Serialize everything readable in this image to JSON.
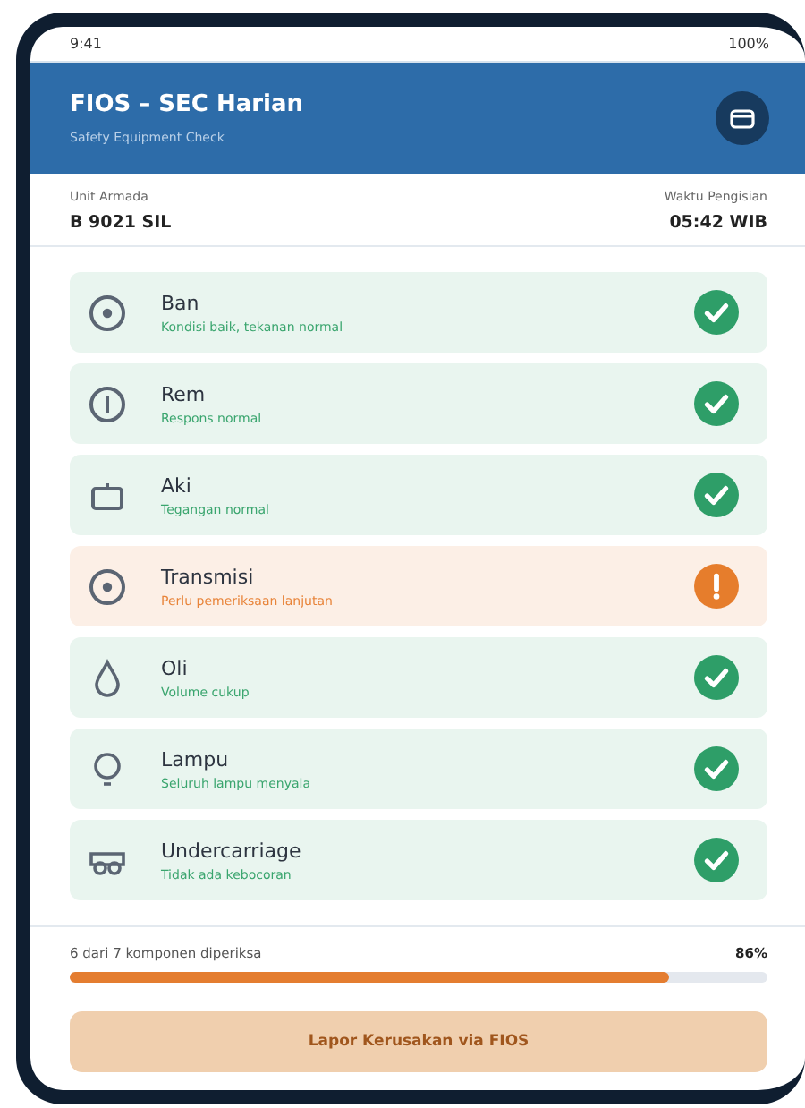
{
  "status_bar": {
    "time": "9:41",
    "battery": "100%"
  },
  "header": {
    "title": "FIOS – SEC Harian",
    "subtitle": "Safety Equipment Check"
  },
  "unit": {
    "label": "Unit Armada",
    "value": "B 9021 SIL"
  },
  "fill_time": {
    "label": "Waktu Pengisian",
    "value": "05:42 WIB"
  },
  "items": [
    {
      "kind": "tire",
      "name": "Ban",
      "note": "Kondisi baik, tekanan normal",
      "warning": false
    },
    {
      "kind": "brake",
      "name": "Rem",
      "note": "Respons normal",
      "warning": false
    },
    {
      "kind": "battery",
      "name": "Aki",
      "note": "Tegangan normal",
      "warning": false
    },
    {
      "kind": "tire",
      "name": "Transmisi",
      "note": "Perlu pemeriksaan lanjutan",
      "warning": true
    },
    {
      "kind": "drop",
      "name": "Oli",
      "note": "Volume cukup",
      "warning": false
    },
    {
      "kind": "bulb",
      "name": "Lampu",
      "note": "Seluruh lampu menyala",
      "warning": false
    },
    {
      "kind": "goggles",
      "name": "Undercarriage",
      "note": "Tidak ada kebocoran",
      "warning": false
    }
  ],
  "progress": {
    "text": "6 dari 7 komponen diperiksa",
    "percent": "86%",
    "level": 0.86
  },
  "report_button": "Lapor Kerusakan via FIOS"
}
